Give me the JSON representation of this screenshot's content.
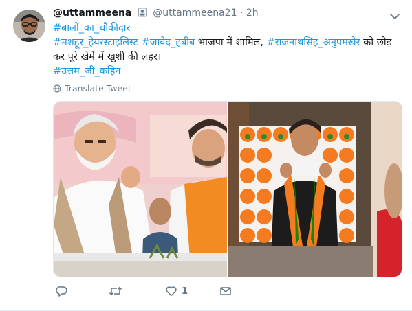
{
  "tweet": {
    "display_name": "@uttammeena",
    "handle": "@uttammeena21",
    "separator": "·",
    "time": "2h",
    "line1_tag": "#बालों_का_चौकीदार",
    "line2_tag1": "#मशहूर_हेयरस्टाइलिस्ट",
    "line2_tag2": "#जावेद_हबीब",
    "line2_text1": " भाजपा में शामिल, ",
    "line2_tag3": "#राजनाथसिंह_अनुपमखेर",
    "line2_text2": " को छोड़ कर पूरे खेमे में खुशी की लहर।",
    "line3_tag": "#उत्तम_जी_कहिन",
    "translate_label": "Translate Tweet",
    "icons": {
      "verified": "badge-icon",
      "caret": "chevron-down-icon",
      "translate": "globe-icon",
      "reply": "reply-icon",
      "retweet": "retweet-icon",
      "like": "heart-icon",
      "dm": "envelope-icon"
    }
  },
  "actions": {
    "like_count": "1"
  },
  "colors": {
    "link": "#1b95e0",
    "secondary": "#657786",
    "text": "#14171a",
    "bjp_orange": "#f47b20",
    "bjp_green": "#138808"
  }
}
